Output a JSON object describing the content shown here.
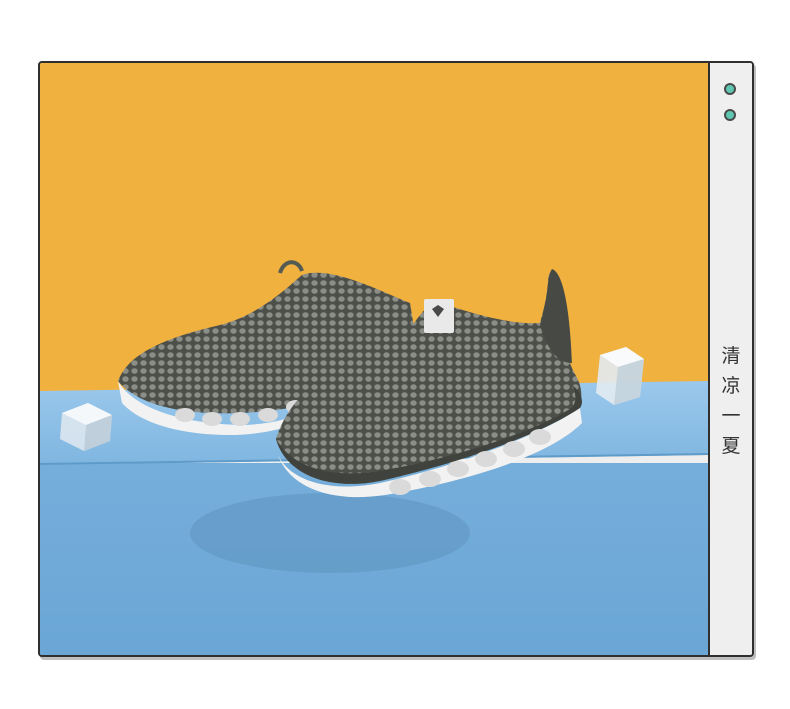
{
  "side_panel": {
    "caption_chars": [
      "清",
      "凉",
      "一",
      "夏"
    ]
  },
  "photo": {
    "background_top_color": "#f0b13f",
    "background_bottom_color": "#79b3de",
    "shoe_color": "#5b5e58",
    "sole_color": "#f2f2f2"
  }
}
